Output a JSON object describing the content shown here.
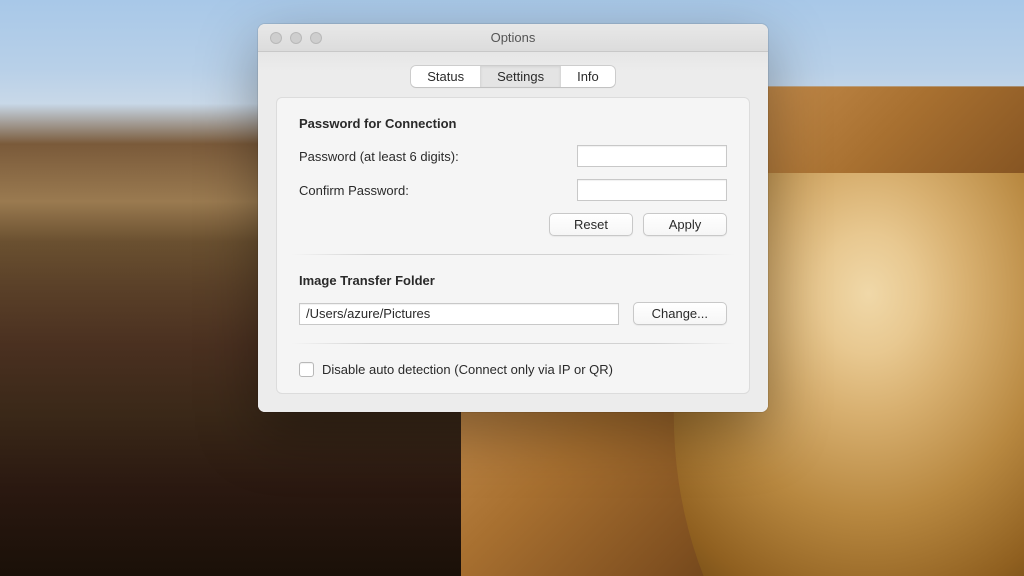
{
  "window": {
    "title": "Options"
  },
  "tabs": {
    "status": "Status",
    "settings": "Settings",
    "info": "Info",
    "active": "settings"
  },
  "password_section": {
    "title": "Password for Connection",
    "password_label": "Password (at least 6 digits):",
    "password_value": "",
    "confirm_label": "Confirm Password:",
    "confirm_value": "",
    "reset_label": "Reset",
    "apply_label": "Apply"
  },
  "folder_section": {
    "title": "Image Transfer Folder",
    "path_value": "/Users/azure/Pictures",
    "change_label": "Change..."
  },
  "detection_section": {
    "checkbox_checked": false,
    "checkbox_label": "Disable auto detection (Connect only via IP or QR)"
  }
}
